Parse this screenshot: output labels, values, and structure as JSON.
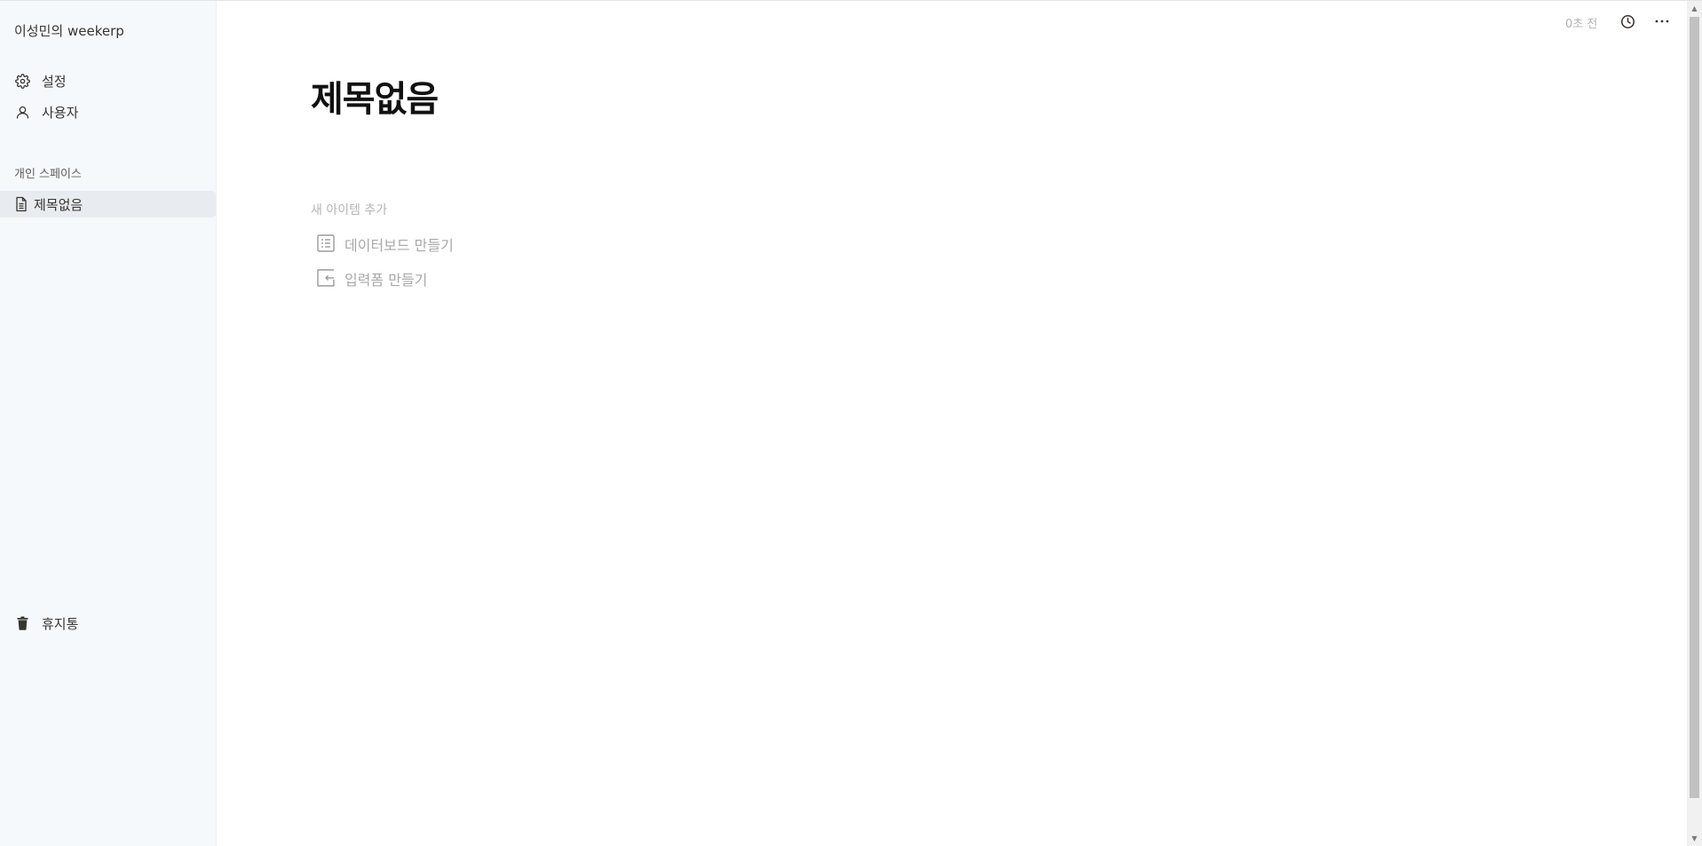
{
  "sidebar": {
    "workspace_title": "이성민의 weekerp",
    "nav": {
      "settings_label": "설정",
      "users_label": "사용자"
    },
    "section_label": "개인 스페이스",
    "pages": [
      {
        "label": "제목없음",
        "icon": "document-icon"
      }
    ],
    "trash_label": "휴지통"
  },
  "topbar": {
    "last_edited": "0초 전",
    "history_icon": "clock-icon",
    "more_icon": "more-horizontal-icon"
  },
  "main": {
    "title": "제목없음",
    "add_section_label": "새 아이템 추가",
    "options": [
      {
        "label": "데이터보드 만들기",
        "icon": "list-board-icon"
      },
      {
        "label": "입력폼 만들기",
        "icon": "form-input-icon"
      }
    ]
  },
  "colors": {
    "sidebar_bg": "#f6f9fc",
    "selected_bg": "#e8ecf0",
    "muted_text": "#a8a8a8",
    "title_text": "#111111"
  }
}
